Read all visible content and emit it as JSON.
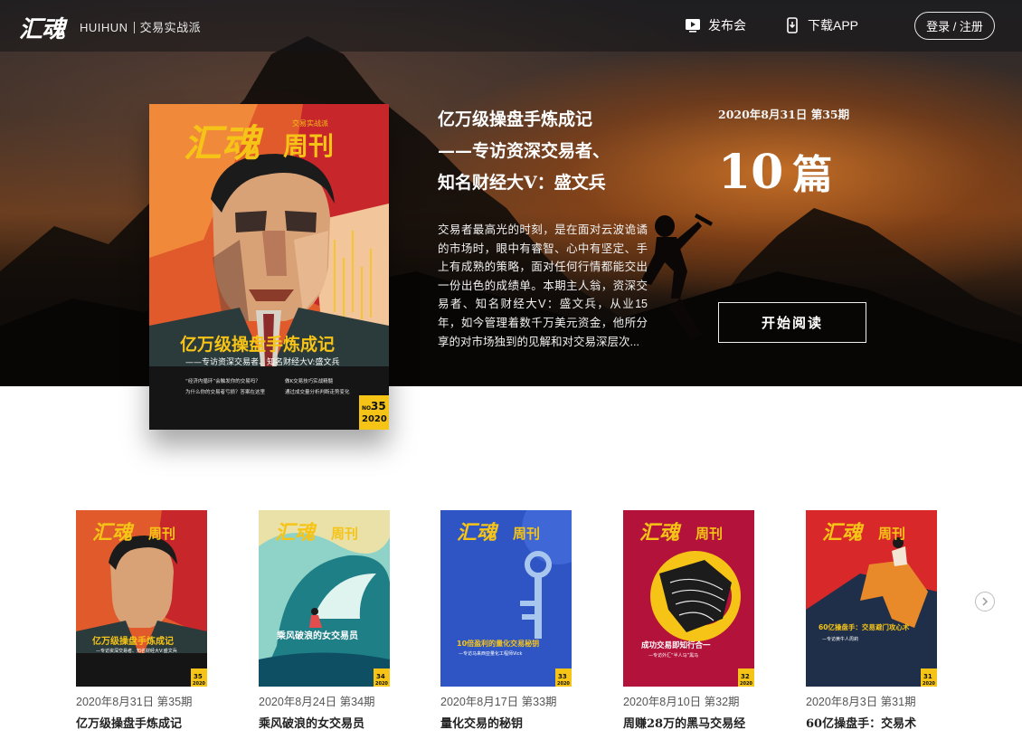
{
  "nav": {
    "logo": "汇魂",
    "brand_en": "HUIHUN",
    "brand_cn": "交易实战派",
    "release_label": "发布会",
    "app_label": "下载APP",
    "login_label": "登录 / 注册"
  },
  "featured": {
    "title_lines": [
      "亿万级操盘手炼成记",
      "——专访资深交易者、",
      "知名财经大V：盛文兵"
    ],
    "description": "交易者最高光的时刻，是在面对云波诡谲的市场时，眼中有睿智、心中有坚定、手上有成熟的策略，面对任何行情都能交出一份出色的成绩单。本期主人翁，资深交易者、知名财经大V：盛文兵，从业15年，如今管理着数千万美元资金，他所分享的对市场独到的见解和对交易深层次...",
    "date_issue": "2020年8月31日 第35期",
    "article_count": "10",
    "article_unit": "篇",
    "read_label": "开始阅读",
    "cover": {
      "masthead_logo": "汇魂",
      "masthead_title": "周刊",
      "masthead_tag": "交易实战派",
      "headline": "亿万级操盘手炼成记",
      "subhead": "——专访资深交易者、知名财经大V:盛文兵",
      "bullets_left": [
        "“经济内循环”会触发你的交易吗？",
        "为什么你的交易者亏损？答案在这里"
      ],
      "bullets_right": [
        "做K交易技巧实战精髓",
        "通过成交量分析判断走势变化"
      ],
      "no_label": "NO.",
      "no_value": "35",
      "year": "2020"
    }
  },
  "issues": [
    {
      "date": "2020年8月31日 第35期",
      "title": "亿万级操盘手炼成记",
      "headline": "亿万级操盘手炼成记",
      "subhead": "—专访资深交易者、知名财经大V:盛文兵",
      "no": "35"
    },
    {
      "date": "2020年8月24日 第34期",
      "title": "乘风破浪的女交易员",
      "headline": "乘风破浪的女交易员",
      "subhead": "",
      "no": "34"
    },
    {
      "date": "2020年8月17日 第33期",
      "title": "量化交易的秘钥",
      "headline": "10倍盈利的量化交易秘钥",
      "subhead": "—专访马来西亚量化工程师Vick",
      "no": "33"
    },
    {
      "date": "2020年8月10日 第32期",
      "title": "周赚28万的黑马交易经",
      "headline": "成功交易即知行合一",
      "subhead": "—专访外汇“半人马”黑马",
      "no": "32"
    },
    {
      "date": "2020年8月3日 第31期",
      "title": "60亿操盘手：交易术",
      "headline": "60亿操盘手：交易避门攻心术",
      "subhead": "—专访黄牛人周莉",
      "no": "31"
    }
  ],
  "thumb_common": {
    "logo": "汇魂",
    "title": "周刊",
    "year": "2020"
  },
  "colors": {
    "hero_orange": "#d4762a",
    "cover_orange": "#e05a2b",
    "cover_red": "#d8282a",
    "cover_yellow": "#f6c417",
    "cover_blue": "#2f55c4"
  }
}
